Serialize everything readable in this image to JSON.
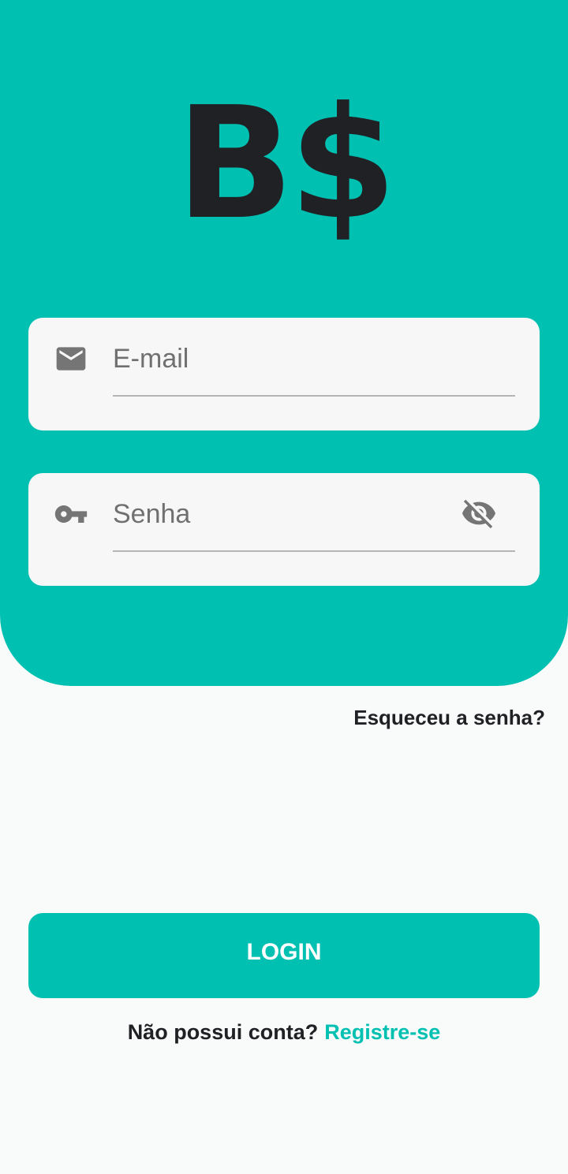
{
  "brand": {
    "logo_text": "B$"
  },
  "colors": {
    "accent": "#00c0b2",
    "card_background": "#f7f7f7",
    "page_background": "#f8fbfa",
    "text_dark": "#202124",
    "placeholder_gray": "#707070"
  },
  "form": {
    "email": {
      "placeholder": "E-mail",
      "value": "",
      "icon": "mail-icon"
    },
    "password": {
      "placeholder": "Senha",
      "value": "",
      "icon": "key-icon",
      "toggle_icon": "eye-off-icon"
    }
  },
  "forgot_password_label": "Esqueceu a senha?",
  "login_button_label": "LOGIN",
  "signup": {
    "prompt": "Não possui conta?",
    "link_label": "Registre-se"
  }
}
